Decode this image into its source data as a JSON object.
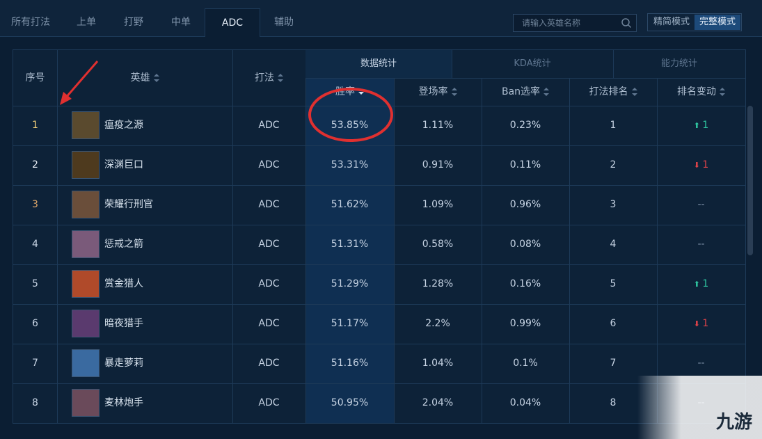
{
  "tabs": [
    "所有打法",
    "上单",
    "打野",
    "中单",
    "ADC",
    "辅助"
  ],
  "active_tab": "ADC",
  "search": {
    "placeholder": "请输入英雄名称",
    "icon": "search-icon"
  },
  "modes": [
    "精简模式",
    "完整模式"
  ],
  "active_mode": "完整模式",
  "group_tabs": [
    "数据统计",
    "KDA统计",
    "能力统计"
  ],
  "headers": {
    "index": "序号",
    "hero": "英雄",
    "role": "打法",
    "winrate": "胜率",
    "pickrate": "登场率",
    "banrate": "Ban选率",
    "rank": "打法排名",
    "change": "排名变动"
  },
  "rows": [
    {
      "idx": "1",
      "hero": "瘟疫之源",
      "role": "ADC",
      "win": "53.85%",
      "pick": "1.11%",
      "ban": "0.23%",
      "rank": "1",
      "dir": "up",
      "change": "1"
    },
    {
      "idx": "2",
      "hero": "深渊巨口",
      "role": "ADC",
      "win": "53.31%",
      "pick": "0.91%",
      "ban": "0.11%",
      "rank": "2",
      "dir": "down",
      "change": "1"
    },
    {
      "idx": "3",
      "hero": "荣耀行刑官",
      "role": "ADC",
      "win": "51.62%",
      "pick": "1.09%",
      "ban": "0.96%",
      "rank": "3",
      "dir": "none",
      "change": "--"
    },
    {
      "idx": "4",
      "hero": "惩戒之箭",
      "role": "ADC",
      "win": "51.31%",
      "pick": "0.58%",
      "ban": "0.08%",
      "rank": "4",
      "dir": "none",
      "change": "--"
    },
    {
      "idx": "5",
      "hero": "赏金猎人",
      "role": "ADC",
      "win": "51.29%",
      "pick": "1.28%",
      "ban": "0.16%",
      "rank": "5",
      "dir": "up",
      "change": "1"
    },
    {
      "idx": "6",
      "hero": "暗夜猎手",
      "role": "ADC",
      "win": "51.17%",
      "pick": "2.2%",
      "ban": "0.99%",
      "rank": "6",
      "dir": "down",
      "change": "1"
    },
    {
      "idx": "7",
      "hero": "暴走萝莉",
      "role": "ADC",
      "win": "51.16%",
      "pick": "1.04%",
      "ban": "0.1%",
      "rank": "7",
      "dir": "none",
      "change": "--"
    },
    {
      "idx": "8",
      "hero": "麦林炮手",
      "role": "ADC",
      "win": "50.95%",
      "pick": "2.04%",
      "ban": "0.04%",
      "rank": "8",
      "dir": "none",
      "change": "--"
    }
  ],
  "avatar_colors": [
    "#5a4a2e",
    "#4e3a1e",
    "#6a4e3a",
    "#7a5a7a",
    "#b04a2a",
    "#5a3a6e",
    "#3a6aa0",
    "#6a4a5a"
  ],
  "colors": {
    "accent": "#1d4a7a",
    "up": "#2fc5a0",
    "down": "#e0434a",
    "annotation": "#e03030"
  },
  "watermark": "九游"
}
